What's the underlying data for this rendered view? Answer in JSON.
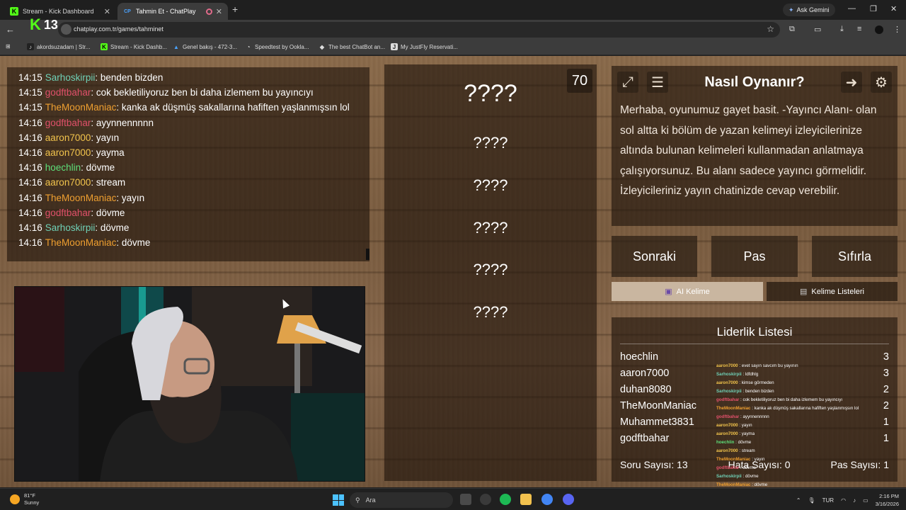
{
  "browser": {
    "tabs": [
      {
        "label": "Stream - Kick Dashboard",
        "active": false
      },
      {
        "label": "Tahmin Et - ChatPlay",
        "active": true
      }
    ],
    "ask_gemini": "Ask Gemini",
    "url": "chatplay.com.tr/games/tahminet",
    "kick_badge": "13",
    "bookmarks": [
      "akordsuzadam | Str...",
      "Stream - Kick Dashb...",
      "Genel bakış - 472-3...",
      "Speedtest by Ookla...",
      "The best ChatBot an...",
      "My JustFly Reservati..."
    ]
  },
  "chat": {
    "messages": [
      {
        "time": "14:15",
        "user": "Sarhoskirpii",
        "color": "#6fd0b6",
        "text": "benden bizden"
      },
      {
        "time": "14:15",
        "user": "godftbahar",
        "color": "#e0506a",
        "text": "cok bekletiliyoruz ben bi daha izlemem bu yayıncıyı"
      },
      {
        "time": "14:15",
        "user": "TheMoonManiac",
        "color": "#f0a030",
        "text": "kanka ak düşmüş sakallarına hafiften yaşlanmışsın lol"
      },
      {
        "time": "14:16",
        "user": "godftbahar",
        "color": "#e0506a",
        "text": "ayynnennnnn"
      },
      {
        "time": "14:16",
        "user": "aaron7000",
        "color": "#f2c44c",
        "text": "yayın"
      },
      {
        "time": "14:16",
        "user": "aaron7000",
        "color": "#f2c44c",
        "text": "yayma"
      },
      {
        "time": "14:16",
        "user": "hoechlin",
        "color": "#5ee07a",
        "text": "dövme"
      },
      {
        "time": "14:16",
        "user": "aaron7000",
        "color": "#f2c44c",
        "text": "stream"
      },
      {
        "time": "14:16",
        "user": "TheMoonManiac",
        "color": "#f0a030",
        "text": "yayın"
      },
      {
        "time": "14:16",
        "user": "godftbahar",
        "color": "#e0506a",
        "text": "dövme"
      },
      {
        "time": "14:16",
        "user": "Sarhoskirpii",
        "color": "#6fd0b6",
        "text": "dövme"
      },
      {
        "time": "14:16",
        "user": "TheMoonManiac",
        "color": "#f0a030",
        "text": "dövme"
      }
    ]
  },
  "game": {
    "timer": "70",
    "main_word": "????",
    "hidden_words": [
      "????",
      "????",
      "????",
      "????",
      "????"
    ]
  },
  "howto": {
    "title": "Nasıl Oynanır?",
    "text": "Merhaba, oyunumuz gayet basit. -Yayıncı Alanı- olan sol altta ki bölüm de yazan kelimeyi izleyicilerinize altında bulunan kelimeleri kullanmadan anlatmaya çalışıyorsunuz. Bu alanı sadece yayıncı görmelidir. İzleyicileriniz yayın chatinizde cevap verebilir."
  },
  "controls": {
    "next": "Sonraki",
    "pass": "Pas",
    "reset": "Sıfırla",
    "ai_word": "AI Kelime",
    "word_lists": "Kelime Listeleri"
  },
  "leaderboard": {
    "title": "Liderlik Listesi",
    "rows": [
      {
        "name": "hoechlin",
        "score": "3"
      },
      {
        "name": "aaron7000",
        "score": "3"
      },
      {
        "name": "duhan8080",
        "score": "2"
      },
      {
        "name": "TheMoonManiac",
        "score": "2"
      },
      {
        "name": "Muhammet3831",
        "score": "1"
      },
      {
        "name": "godftbahar",
        "score": "1"
      }
    ],
    "question_count": "Soru Sayısı: 13",
    "error_count": "Hata Sayısı: 0",
    "pass_count": "Pas Sayısı: 1"
  },
  "overlay_chat": [
    {
      "user": "aaron7000",
      "color": "#f2c44c",
      "text": "evet sayın savcım bu yayının"
    },
    {
      "user": "Sarhoskirpii",
      "color": "#6fd0b6",
      "text": "ldfdhlg"
    },
    {
      "user": "aaron7000",
      "color": "#f2c44c",
      "text": "kimse görmeden"
    },
    {
      "user": "Sarhoskirpii",
      "color": "#6fd0b6",
      "text": "benden bizden"
    },
    {
      "user": "godftbahar",
      "color": "#e0506a",
      "text": "cok bekletiliyoruz ben bi daha izlemem bu yayıncıyı"
    },
    {
      "user": "TheMoonManiac",
      "color": "#f0a030",
      "text": "kanka ak düşmüş sakallarına hafiften yaşlanmışsın lol"
    },
    {
      "user": "godftbahar",
      "color": "#e0506a",
      "text": "ayynnennnnn"
    },
    {
      "user": "aaron7000",
      "color": "#f2c44c",
      "text": "yayın"
    },
    {
      "user": "aaron7000",
      "color": "#f2c44c",
      "text": "yayma"
    },
    {
      "user": "hoechlin",
      "color": "#5ee07a",
      "text": "dövme"
    },
    {
      "user": "aaron7000",
      "color": "#f2c44c",
      "text": "stream"
    },
    {
      "user": "TheMoonManiac",
      "color": "#f0a030",
      "text": "yayın"
    },
    {
      "user": "godftbahar",
      "color": "#e0506a",
      "text": "dövme"
    },
    {
      "user": "Sarhoskirpii",
      "color": "#6fd0b6",
      "text": "dövme"
    },
    {
      "user": "TheMoonManiac",
      "color": "#f0a030",
      "text": "dövme"
    }
  ],
  "taskbar": {
    "temp": "81°F",
    "condition": "Sunny",
    "search": "Ara",
    "lang": "TUR",
    "time": "2:16 PM",
    "date": "3/16/2026"
  }
}
